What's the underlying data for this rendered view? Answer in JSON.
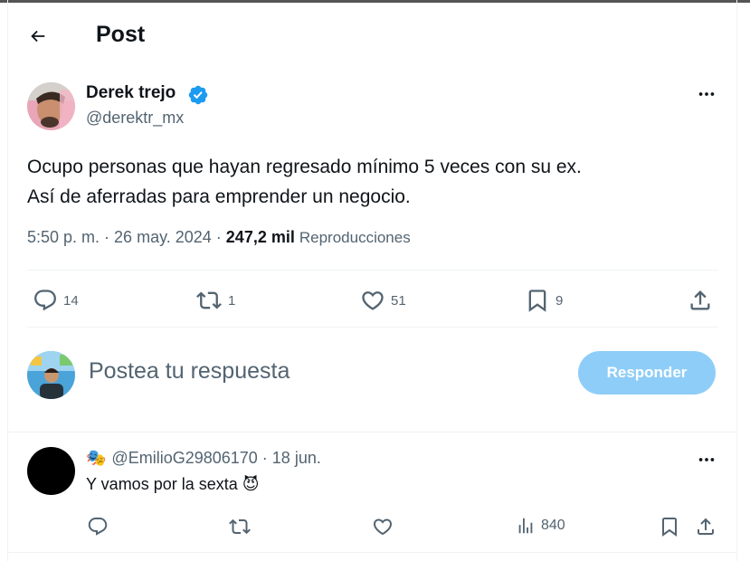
{
  "header": {
    "title": "Post",
    "back_icon": "arrow-left-icon"
  },
  "post": {
    "author": {
      "name": "Derek trejo",
      "handle": "@derektr_mx",
      "verified": true,
      "verified_color": "#1d9bf0"
    },
    "text": "Ocupo personas que hayan regresado mínimo 5 veces con su ex.\nAsí de aferradas para emprender un negocio.",
    "time": "5:50 p. m.",
    "separator": " · ",
    "date": "26 may. 2024",
    "views_count": "247,2 mil",
    "views_label": "Reproducciones",
    "actions": {
      "replies": "14",
      "reposts": "1",
      "likes": "51",
      "bookmarks": "9"
    }
  },
  "composer": {
    "placeholder": "Postea tu respuesta",
    "button_label": "Responder",
    "button_color": "#8ecdf8"
  },
  "reply": {
    "emoji": "🎭",
    "handle": "@EmilioG29806170",
    "separator": " · ",
    "date": "18 jun.",
    "text": "Y vamos por la sexta",
    "text_emoji": "😈",
    "actions": {
      "views": "840"
    }
  },
  "colors": {
    "text_primary": "#0f1419",
    "text_secondary": "#536471",
    "divider": "#eff3f4",
    "accent": "#1d9bf0"
  }
}
